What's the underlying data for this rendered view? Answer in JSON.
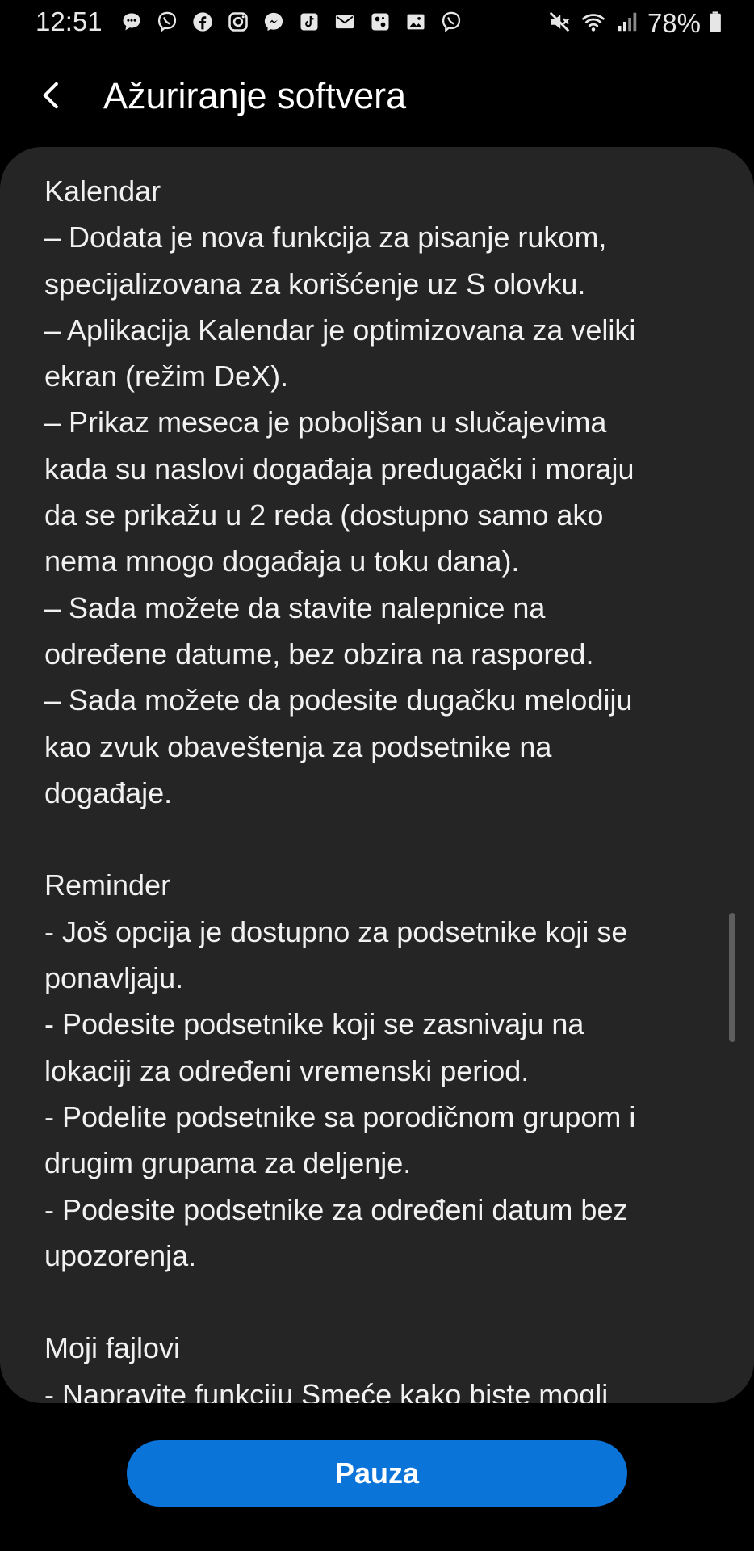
{
  "status_bar": {
    "time": "12:51",
    "battery_percent": "78%",
    "notification_icons": [
      "chat-icon",
      "viber-icon",
      "facebook-icon",
      "instagram-icon",
      "messenger-icon",
      "tiktok-icon",
      "mail-icon",
      "photos-app-icon",
      "gallery-icon",
      "viber-icon"
    ],
    "system_icons": [
      "mute-icon",
      "wifi-icon",
      "signal-icon",
      "battery-icon"
    ]
  },
  "header": {
    "title": "Ažuriranje softvera"
  },
  "content": {
    "lines": [
      "Kalendar",
      "– Dodata je nova funkcija za pisanje rukom,",
      "specijalizovana za korišćenje uz S olovku.",
      "– Aplikacija Kalendar je optimizovana za veliki",
      "ekran (režim DeX).",
      "– Prikaz meseca je poboljšan u slučajevima",
      "kada su naslovi događaja predugački i moraju",
      "da se prikažu u 2 reda (dostupno samo ako",
      "nema mnogo događaja u toku dana).",
      "– Sada možete da stavite nalepnice na",
      "određene datume, bez obzira na raspored.",
      "– Sada možete da podesite dugačku melodiju",
      "kao zvuk obaveštenja za podsetnike na",
      "događaje.",
      "",
      "Reminder",
      "- Još opcija je dostupno za podsetnike koji se",
      "ponavljaju.",
      "- Podesite podsetnike koji se zasnivaju na",
      "lokaciji za određeni vremenski period.",
      "- Podelite podsetnike sa porodičnom grupom i",
      "drugim grupama za deljenje.",
      "- Podesite podsetnike za određeni datum bez",
      "upozorenja.",
      "",
      "Moji fajlovi",
      "- Napravite funkciju Smeće kako biste mogli"
    ]
  },
  "footer": {
    "pause_label": "Pauza"
  },
  "colors": {
    "background": "#000000",
    "card": "#252525",
    "accent": "#0b74d8",
    "text": "#f1f1f1"
  }
}
